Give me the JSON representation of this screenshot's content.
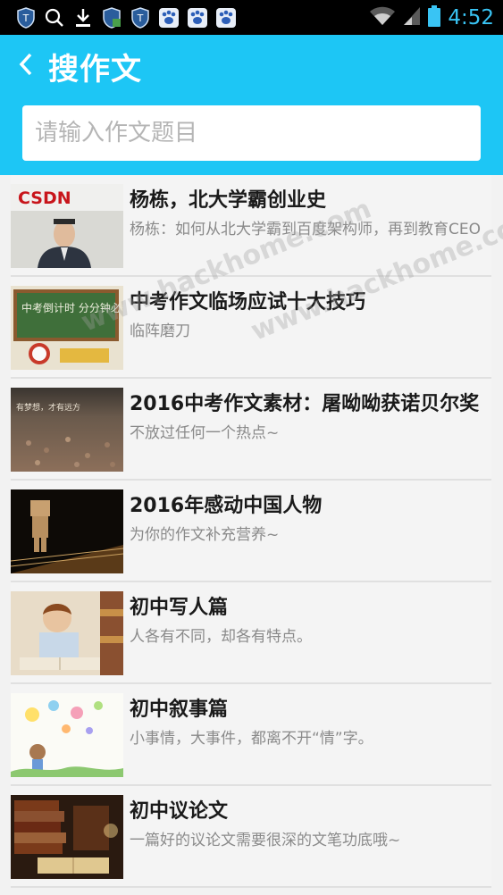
{
  "status_bar": {
    "time": "4:52"
  },
  "header": {
    "title": "搜作文",
    "search_placeholder": "请输入作文题目"
  },
  "list": {
    "items": [
      {
        "title": "杨栋，北大学霸创业史",
        "desc": "杨栋：如何从北大学霸到百度架构师，再到教育CEO",
        "thumb_text": "CSDN"
      },
      {
        "title": "中考作文临场应试十大技巧",
        "desc": "临阵磨刀",
        "thumb_text": "中考倒计时 分分钟必争"
      },
      {
        "title": "2016中考作文素材：屠呦呦获诺贝尔奖",
        "desc": "不放过任何一个热点~",
        "thumb_text": "有梦想，才有远方"
      },
      {
        "title": "2016年感动中国人物",
        "desc": "为你的作文补充营养~",
        "thumb_text": ""
      },
      {
        "title": "初中写人篇",
        "desc": "人各有不同，却各有特点。",
        "thumb_text": ""
      },
      {
        "title": "初中叙事篇",
        "desc": "小事情，大事件，都离不开“情”字。",
        "thumb_text": ""
      },
      {
        "title": "初中议论文",
        "desc": "一篇好的议论文需要很深的文笔功底哦~",
        "thumb_text": ""
      }
    ]
  },
  "watermark": {
    "text": "www.hackhome.com"
  },
  "colors": {
    "accent": "#1dc6f5",
    "clock": "#39c4f4"
  }
}
